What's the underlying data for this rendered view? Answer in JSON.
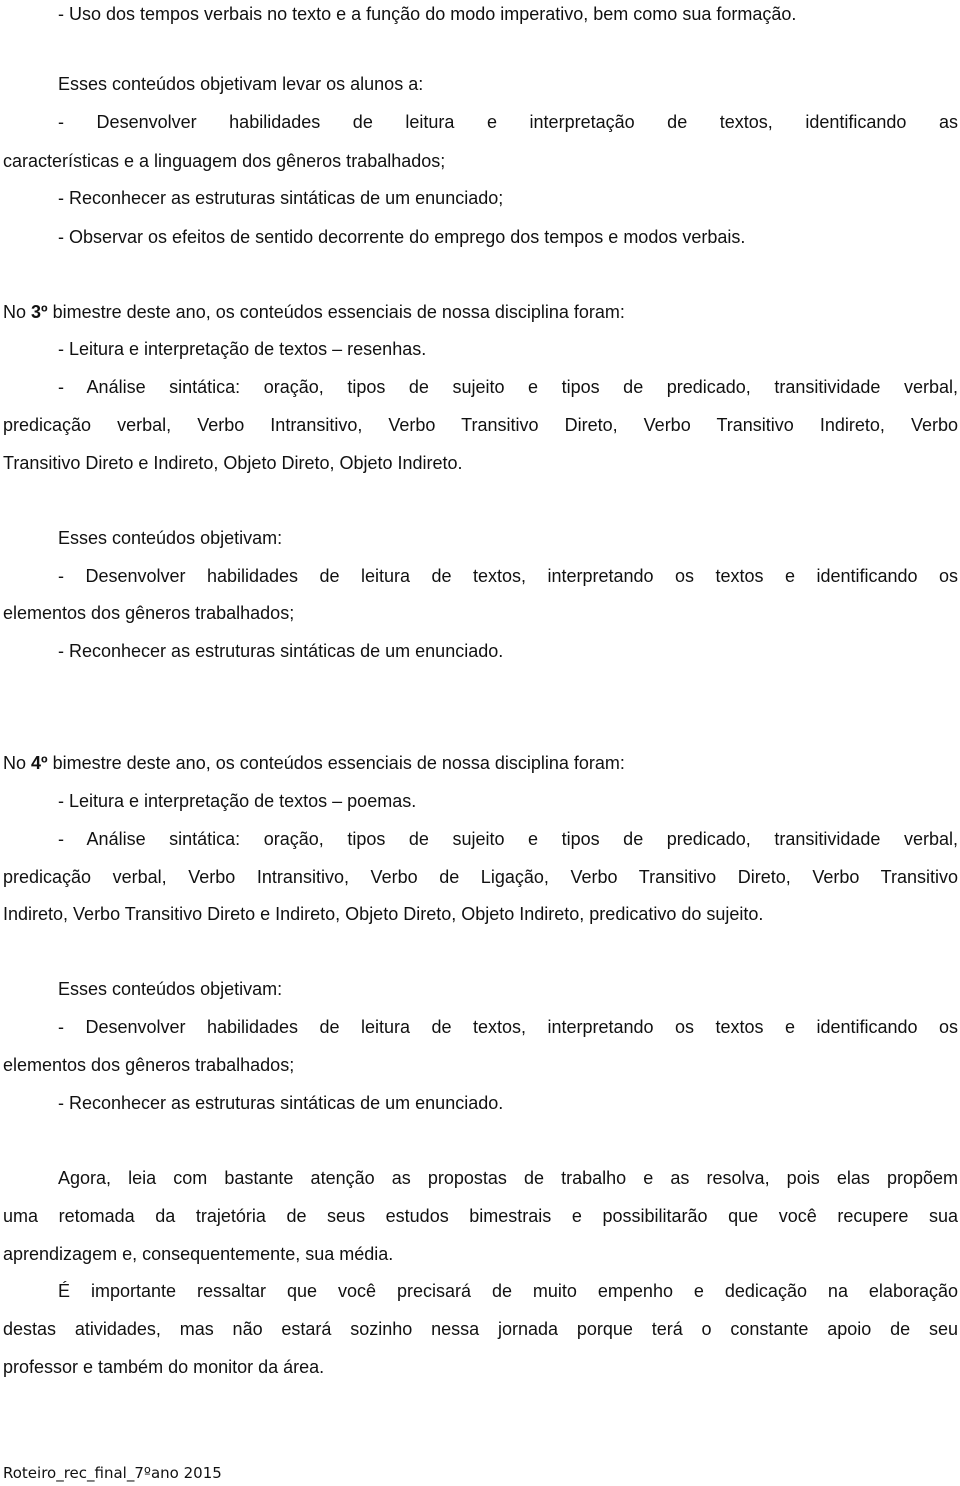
{
  "doc": {
    "intro_item": "- Uso dos tempos verbais no texto e a função do modo imperativo, bem como sua formação.",
    "obj2": {
      "heading": "Esses conteúdos objetivam levar os alunos a:",
      "item1_l1": "- Desenvolver habilidades de leitura e interpretação de textos, identificando as",
      "item1_l2": "características e a linguagem dos gêneros trabalhados;",
      "item2": "- Reconhecer as estruturas sintáticas de um enunciado;",
      "item3": "- Observar os efeitos de sentido decorrente do emprego dos tempos e modos verbais."
    },
    "b3": {
      "prefix": "No ",
      "ordinal": "3º",
      "suffix": " bimestre deste ano, os conteúdos essenciais de nossa disciplina foram:",
      "item1": "- Leitura e interpretação de textos – resenhas.",
      "item2_l1": "- Análise sintática: oração, tipos de sujeito e tipos de predicado, transitividade verbal,",
      "item2_l2": "predicação verbal, Verbo Intransitivo, Verbo Transitivo Direto, Verbo Transitivo Indireto, Verbo",
      "item2_l3": "Transitivo Direto e Indireto, Objeto Direto, Objeto Indireto.",
      "obj_heading": "Esses conteúdos objetivam:",
      "obj1_l1": "- Desenvolver habilidades de leitura de textos, interpretando os textos e identificando os",
      "obj1_l2": "elementos dos gêneros trabalhados;",
      "obj2": "- Reconhecer as estruturas sintáticas de um enunciado."
    },
    "b4": {
      "prefix": "No ",
      "ordinal": "4º",
      "suffix": " bimestre deste ano, os conteúdos essenciais de nossa disciplina foram:",
      "item1": "- Leitura e interpretação de textos – poemas.",
      "item2_l1": "- Análise sintática: oração, tipos de sujeito e tipos de predicado, transitividade verbal,",
      "item2_l2": "predicação verbal, Verbo Intransitivo, Verbo de Ligação, Verbo Transitivo Direto, Verbo Transitivo",
      "item2_l3": "Indireto, Verbo Transitivo Direto e Indireto, Objeto Direto, Objeto Indireto, predicativo do sujeito.",
      "obj_heading": "Esses conteúdos objetivam:",
      "obj1_l1": "- Desenvolver habilidades de leitura de textos, interpretando os textos e identificando os",
      "obj1_l2": "elementos dos gêneros trabalhados;",
      "obj2": "- Reconhecer as estruturas sintáticas de um enunciado."
    },
    "closing": {
      "p1_l1": "Agora, leia com bastante atenção as propostas de trabalho e as resolva, pois elas propõem",
      "p1_l2": "uma retomada da trajetória de seus estudos bimestrais e possibilitarão que você recupere sua",
      "p1_l3": "aprendizagem e, consequentemente, sua média.",
      "p2_l1": "É importante ressaltar que você precisará de muito empenho e dedicação na elaboração",
      "p2_l2": "destas atividades, mas não estará sozinho nessa jornada porque terá o constante apoio de seu",
      "p2_l3": "professor e também do monitor da área."
    },
    "footer": "Roteiro_rec_final_7ºano 2015"
  }
}
